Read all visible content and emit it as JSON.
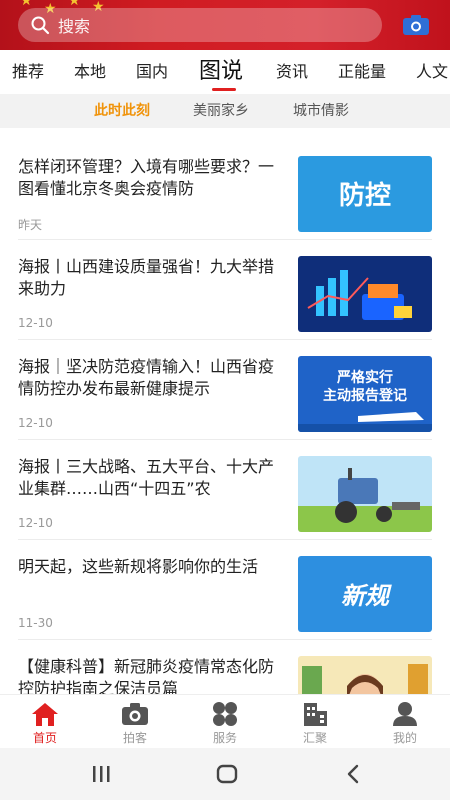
{
  "search": {
    "placeholder": "搜索",
    "search_icon": "search-icon",
    "camera_icon": "camera-icon"
  },
  "categories": [
    {
      "label": "推荐",
      "active": false
    },
    {
      "label": "本地",
      "active": false
    },
    {
      "label": "国内",
      "active": false
    },
    {
      "label": "图说",
      "active": true
    },
    {
      "label": "资讯",
      "active": false
    },
    {
      "label": "正能量",
      "active": false
    },
    {
      "label": "人文",
      "active": false
    }
  ],
  "subtabs": [
    {
      "label": "此时此刻",
      "active": true
    },
    {
      "label": "美丽家乡",
      "active": false
    },
    {
      "label": "城市倩影",
      "active": false
    }
  ],
  "articles": [
    {
      "title": "怎样闭环管理？入境有哪些要求？一图看懂北京冬奥会疫情防",
      "date": "昨天",
      "thumb_text": "防控"
    },
    {
      "title": "海报丨山西建设质量强省！九大举措来助力",
      "date": "12-10",
      "thumb_text": ""
    },
    {
      "title": "海报｜坚决防范疫情输入！山西省疫情防控办发布最新健康提示",
      "date": "12-10",
      "thumb_text": "严格实行\n主动报告登记"
    },
    {
      "title": "海报丨三大战略、五大平台、十大产业集群……山西“十四五”农",
      "date": "12-10",
      "thumb_text": ""
    },
    {
      "title": "明天起，这些新规将影响你的生活",
      "date": "11-30",
      "thumb_text": "新规"
    },
    {
      "title": "【健康科普】新冠肺炎疫情常态化防控防护指南之保洁员篇",
      "date": "",
      "thumb_text": ""
    }
  ],
  "nav": [
    {
      "label": "首页",
      "icon": "home-icon",
      "active": true
    },
    {
      "label": "拍客",
      "icon": "camera-icon",
      "active": false
    },
    {
      "label": "服务",
      "icon": "grid-icon",
      "active": false
    },
    {
      "label": "汇聚",
      "icon": "building-icon",
      "active": false
    },
    {
      "label": "我的",
      "icon": "user-icon",
      "active": false
    }
  ],
  "colors": {
    "brand_red": "#d4202a",
    "active_orange": "#f0930a",
    "nav_active": "#e02020"
  }
}
